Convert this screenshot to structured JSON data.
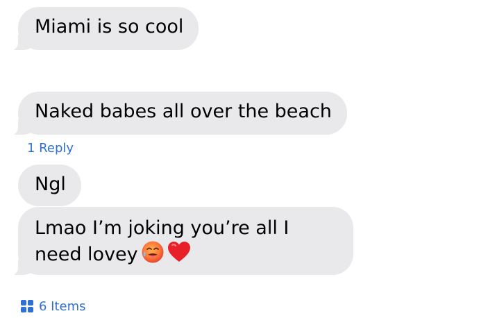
{
  "messages": [
    {
      "text": "Miami is so cool"
    },
    {
      "text": "Naked babes all over the beach"
    },
    {
      "text": "Ngl"
    },
    {
      "text": "Lmao I’m joking you’re all I need lovey",
      "emojis": [
        "hot-face-emoji",
        "red-heart-emoji"
      ]
    }
  ],
  "reply_link": "1 Reply",
  "items_link": "6 Items",
  "colors": {
    "bubble": "#e9e9eb",
    "link": "#2f6fd6"
  }
}
